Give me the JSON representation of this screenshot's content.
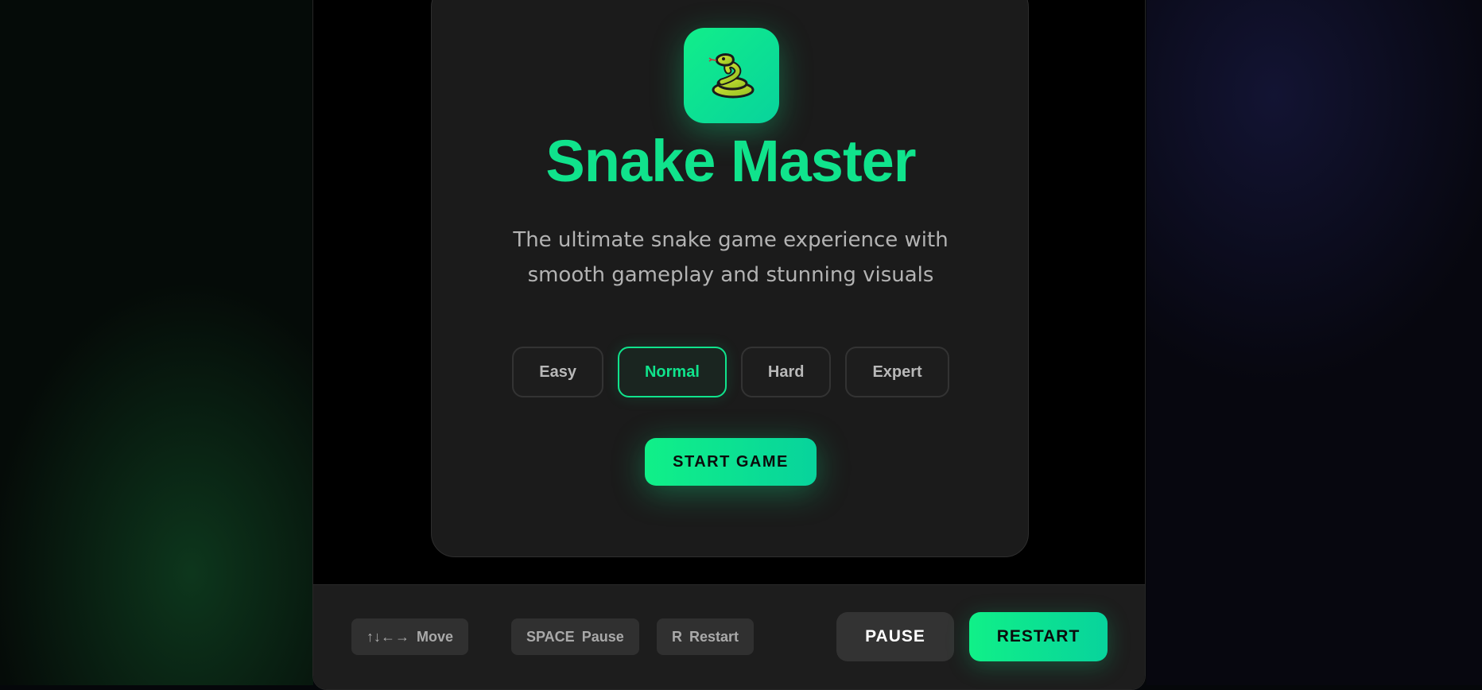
{
  "menu": {
    "logo_icon": "snake-icon",
    "title": "Snake Master",
    "subtitle": "The ultimate snake game experience with smooth gameplay and stunning visuals",
    "difficulties": [
      {
        "label": "Easy",
        "selected": false
      },
      {
        "label": "Normal",
        "selected": true
      },
      {
        "label": "Hard",
        "selected": false
      },
      {
        "label": "Expert",
        "selected": false
      }
    ],
    "start_label": "START GAME"
  },
  "controls": {
    "move": {
      "key": "↑↓←→",
      "label": "Move"
    },
    "pause": {
      "key": "SPACE",
      "label": "Pause"
    },
    "restart": {
      "key": "R",
      "label": "Restart"
    },
    "pause_button": "PAUSE",
    "restart_button": "RESTART"
  },
  "colors": {
    "accent": "#10e38c",
    "card_bg": "#1b1b1b",
    "bar_bg": "#1d1d1d"
  }
}
